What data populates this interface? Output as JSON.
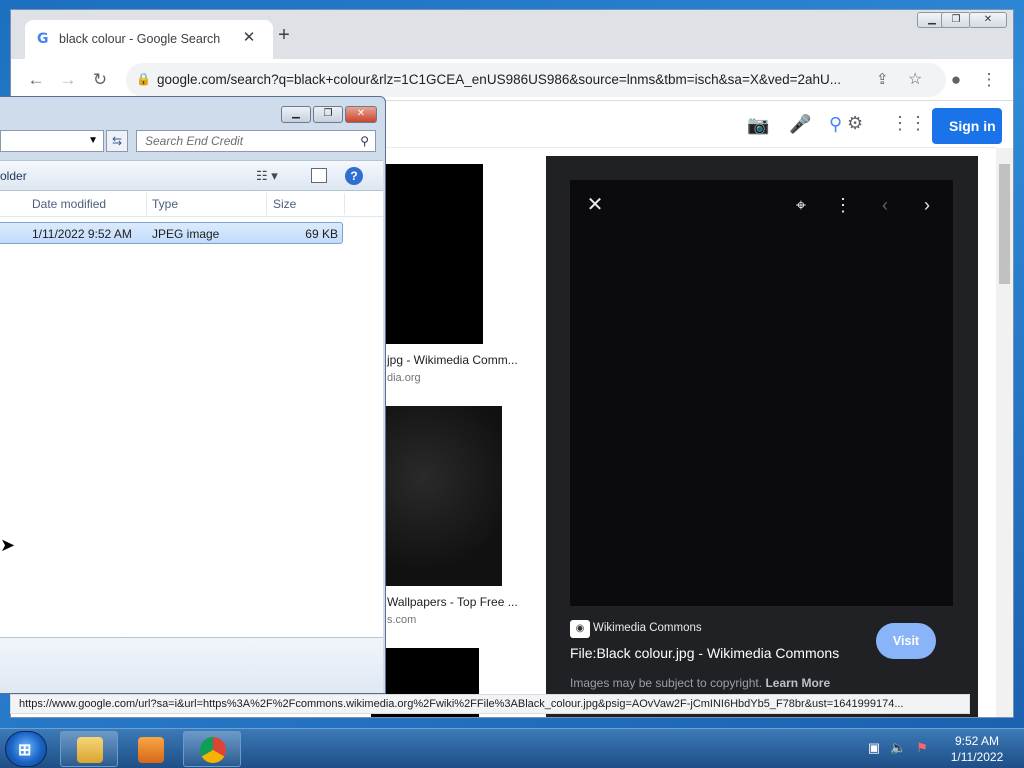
{
  "browser": {
    "tab_title": "black colour - Google Search",
    "new_tab_symbol": "+",
    "url": "google.com/search?q=black+colour&rlz=1C1GCEA_enUS986US986&source=lnms&tbm=isch&sa=X&ved=2ahU...",
    "status_url": "https://www.google.com/url?sa=i&url=https%3A%2F%2Fcommons.wikimedia.org%2Fwiki%2FFile%3ABlack_colour.jpg&psig=AOvVaw2F-jCmINI6HbdYb5_F78br&ust=1641999174..."
  },
  "google": {
    "sign_in": "Sign in",
    "results": [
      {
        "caption": "jpg - Wikimedia Comm...",
        "source": "dia.org"
      },
      {
        "caption": "Wallpapers - Top Free ...",
        "source": "s.com"
      }
    ],
    "viewer": {
      "source_name": "Wikimedia Commons",
      "title": "File:Black colour.jpg - Wikimedia Commons",
      "visit_label": "Visit",
      "copyright_text": "Images may be subject to copyright.",
      "learn_more": "Learn More"
    }
  },
  "explorer": {
    "search_placeholder": "Search End Credit",
    "command_label": "older",
    "columns": {
      "date": "Date modified",
      "type": "Type",
      "size": "Size"
    },
    "file": {
      "date": "1/11/2022 9:52 AM",
      "type": "JPEG image",
      "size": "69 KB"
    }
  },
  "taskbar": {
    "time": "9:52 AM",
    "date": "1/11/2022"
  }
}
